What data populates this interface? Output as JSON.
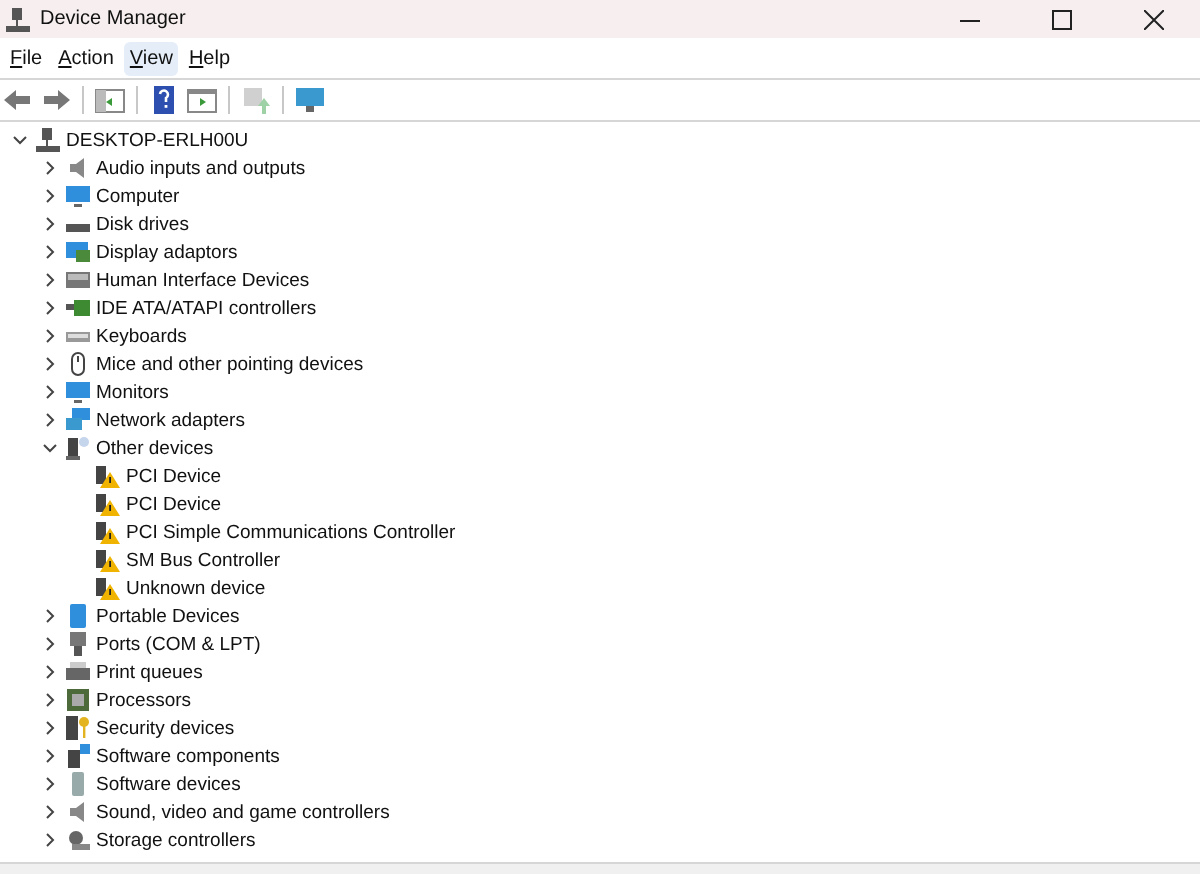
{
  "window": {
    "title": "Device Manager"
  },
  "menu": [
    {
      "label": "File",
      "selected": false
    },
    {
      "label": "Action",
      "selected": false
    },
    {
      "label": "View",
      "selected": true
    },
    {
      "label": "Help",
      "selected": false
    }
  ],
  "toolbar": [
    {
      "kind": "back",
      "disabled": false
    },
    {
      "kind": "forward",
      "disabled": false
    },
    {
      "kind": "separator"
    },
    {
      "kind": "tree"
    },
    {
      "kind": "separator"
    },
    {
      "kind": "help",
      "disabled": false
    },
    {
      "kind": "panel",
      "disabled": false
    },
    {
      "kind": "separator"
    },
    {
      "kind": "update",
      "disabled": true
    },
    {
      "kind": "separator"
    },
    {
      "kind": "scan",
      "disabled": false
    }
  ],
  "tree": {
    "label": "DESKTOP-ERLH00U",
    "kind": "computer-root",
    "expanded": true,
    "children": [
      {
        "label": "Audio inputs and outputs",
        "kind": "speaker",
        "expanded": false
      },
      {
        "label": "Computer",
        "kind": "monitor",
        "expanded": false
      },
      {
        "label": "Disk drives",
        "kind": "disk",
        "expanded": false
      },
      {
        "label": "Display adaptors",
        "kind": "display",
        "expanded": false
      },
      {
        "label": "Human Interface Devices",
        "kind": "hid",
        "expanded": false
      },
      {
        "label": "IDE ATA/ATAPI controllers",
        "kind": "card",
        "expanded": false
      },
      {
        "label": "Keyboards",
        "kind": "keyboard",
        "expanded": false
      },
      {
        "label": "Mice and other pointing devices",
        "kind": "mouse",
        "expanded": false
      },
      {
        "label": "Monitors",
        "kind": "monitor",
        "expanded": false
      },
      {
        "label": "Network adapters",
        "kind": "network",
        "expanded": false
      },
      {
        "label": "Other devices",
        "kind": "other",
        "expanded": true,
        "children": [
          {
            "label": "PCI Device",
            "kind": "warning"
          },
          {
            "label": "PCI Device",
            "kind": "warning"
          },
          {
            "label": "PCI Simple Communications Controller",
            "kind": "warning"
          },
          {
            "label": "SM Bus Controller",
            "kind": "warning"
          },
          {
            "label": "Unknown device",
            "kind": "warning"
          }
        ]
      },
      {
        "label": "Portable Devices",
        "kind": "portable",
        "expanded": false
      },
      {
        "label": "Ports (COM & LPT)",
        "kind": "port",
        "expanded": false
      },
      {
        "label": "Print queues",
        "kind": "printer",
        "expanded": false
      },
      {
        "label": "Processors",
        "kind": "chip",
        "expanded": false
      },
      {
        "label": "Security devices",
        "kind": "security",
        "expanded": false
      },
      {
        "label": "Software components",
        "kind": "component",
        "expanded": false
      },
      {
        "label": "Software devices",
        "kind": "software",
        "expanded": false
      },
      {
        "label": "Sound, video and game controllers",
        "kind": "speaker",
        "expanded": false
      },
      {
        "label": "Storage controllers",
        "kind": "storage",
        "expanded": false
      }
    ]
  }
}
